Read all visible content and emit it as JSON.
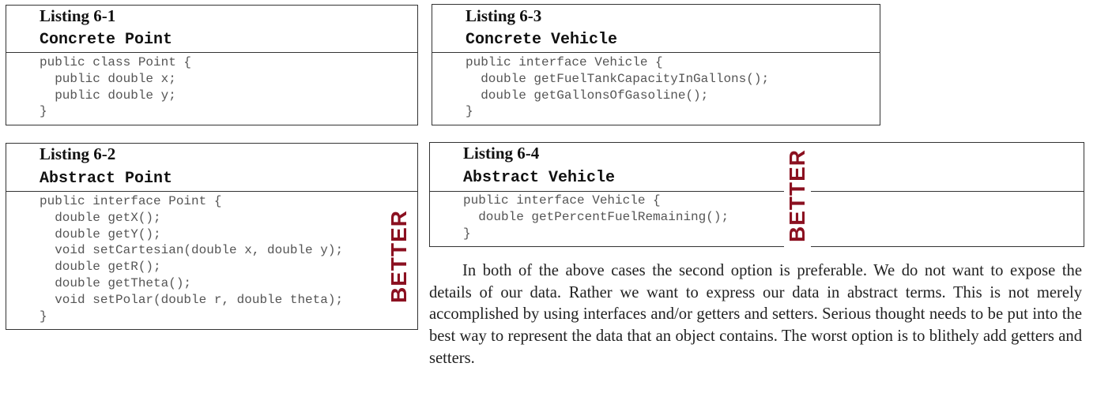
{
  "listings": [
    {
      "title": "Listing 6-1",
      "subtitle": "Concrete Point",
      "code": [
        "public class Point {",
        "  public double x;",
        "  public double y;",
        "}"
      ]
    },
    {
      "title": "Listing 6-2",
      "subtitle": "Abstract Point",
      "code": [
        "public interface Point {",
        "  double getX();",
        "  double getY();",
        "  void setCartesian(double x, double y);",
        "  double getR();",
        "  double getTheta();",
        "  void setPolar(double r, double theta);",
        "}"
      ]
    },
    {
      "title": "Listing 6-3",
      "subtitle": "Concrete Vehicle",
      "code": [
        "public interface Vehicle {",
        "  double getFuelTankCapacityInGallons();",
        "  double getGallonsOfGasoline();",
        "}"
      ]
    },
    {
      "title": "Listing 6-4",
      "subtitle": "Abstract Vehicle",
      "code": [
        "public interface Vehicle {",
        "  double getPercentFuelRemaining();",
        "}"
      ]
    }
  ],
  "better_label": "BETTER",
  "paragraph": "In both of the above cases the second option is preferable. We do not want to expose the details of our data. Rather we want to express our data in abstract terms. This is not merely accomplished by using interfaces and/or getters and setters. Serious thought needs to be put into the best way to represent the data that an object contains. The worst option is to blithely add getters and setters.",
  "colors": {
    "better": "#8b1020",
    "code": "#555555",
    "rule": "#333333"
  }
}
